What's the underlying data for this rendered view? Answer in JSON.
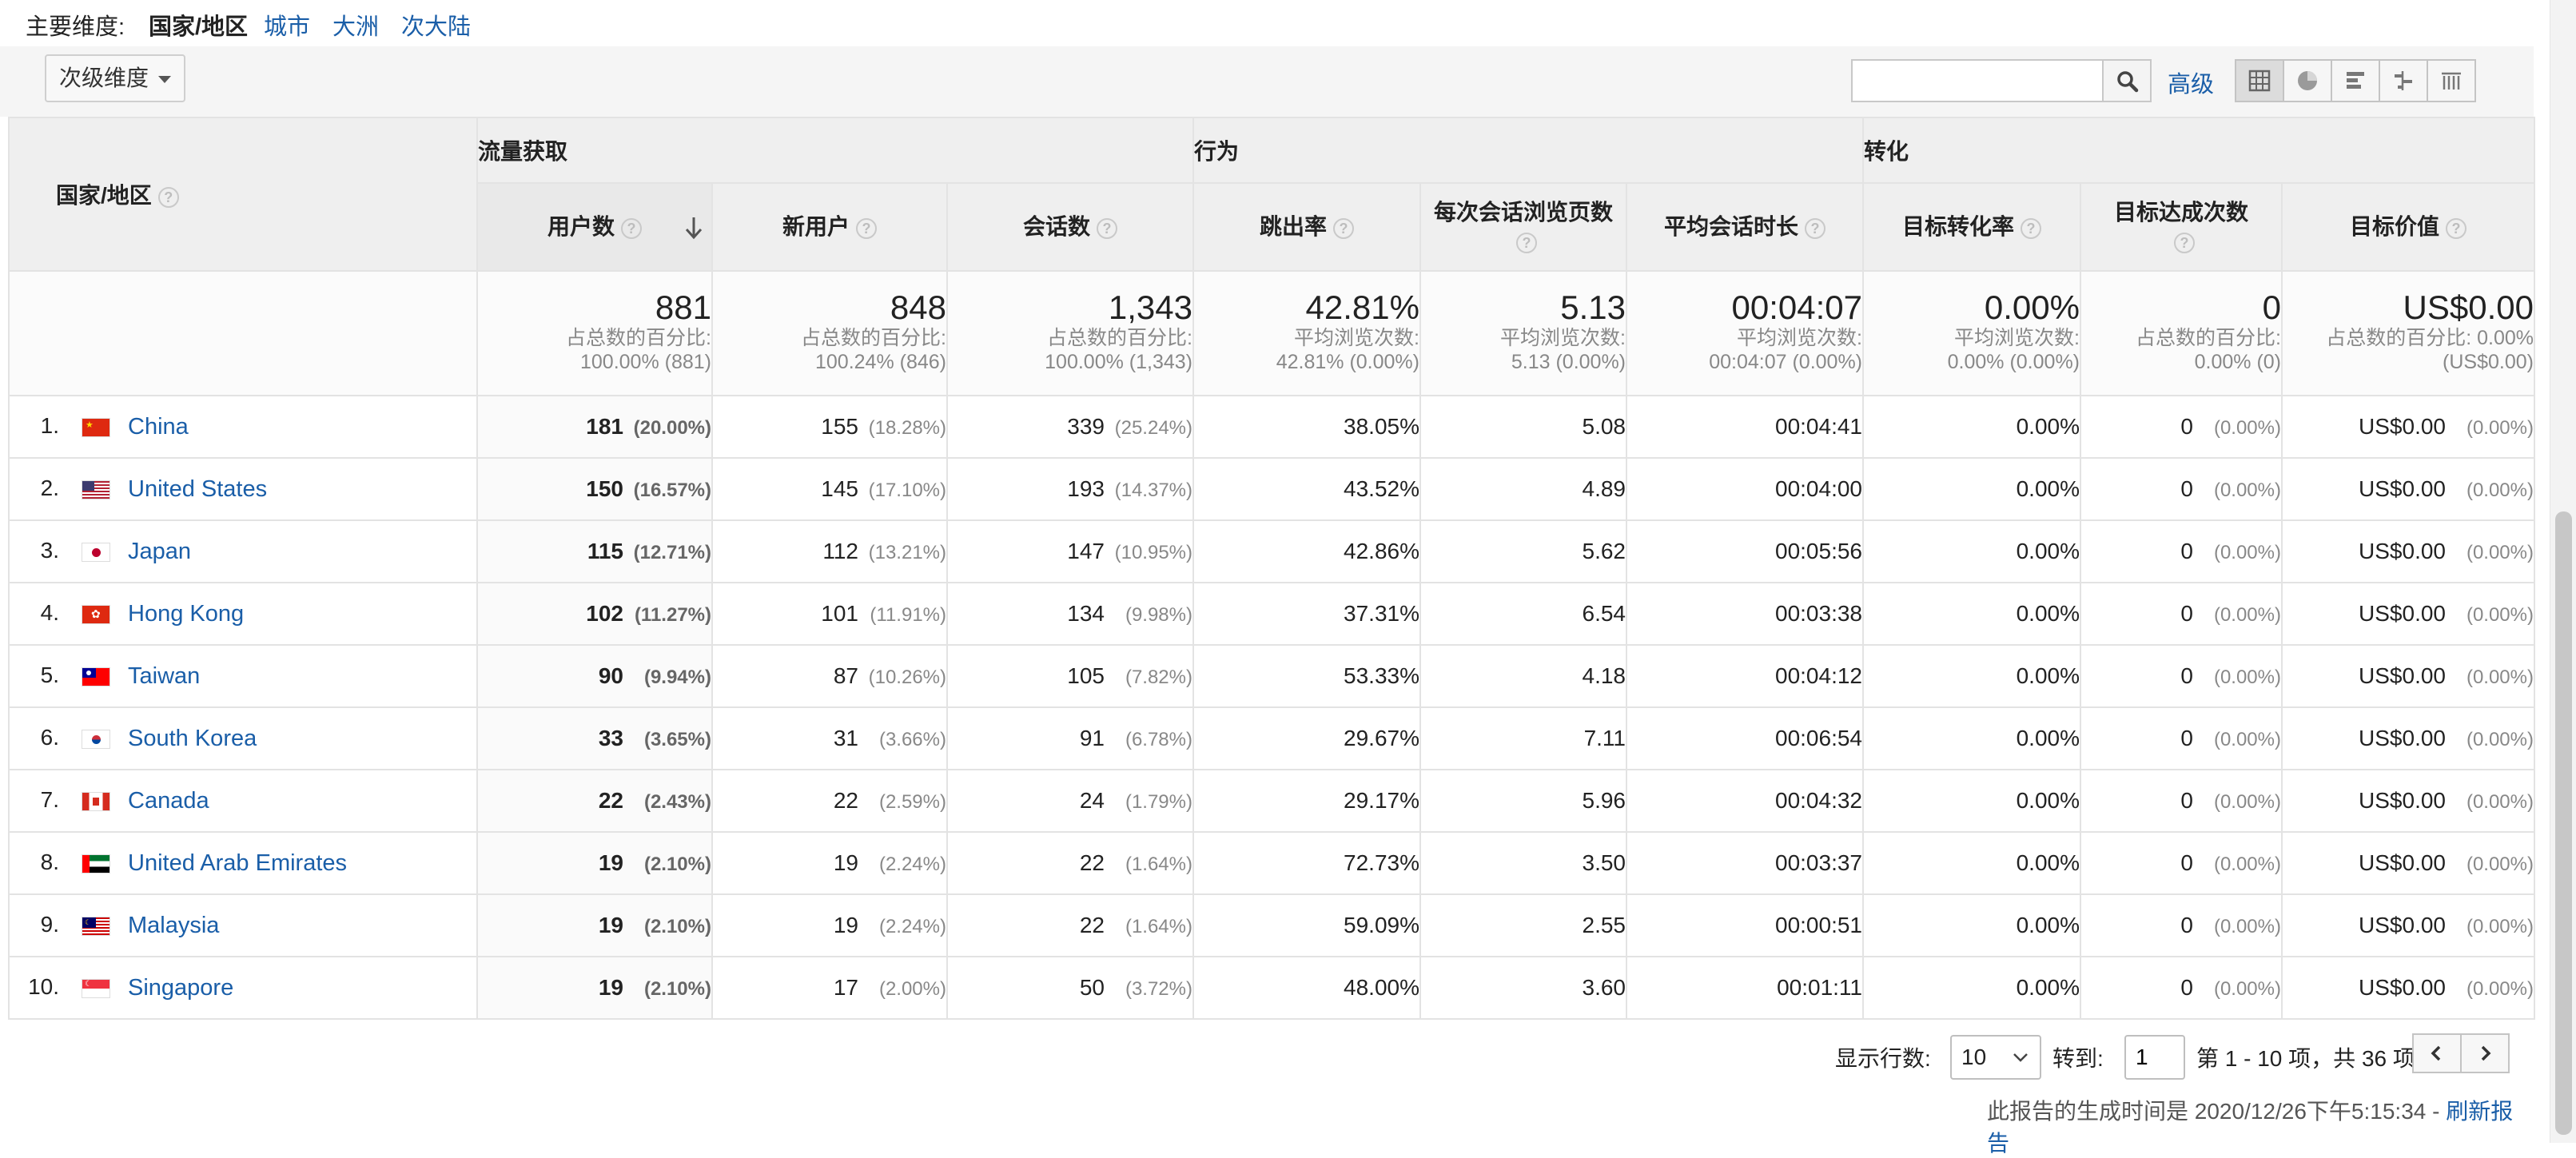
{
  "dimensions": {
    "label": "主要维度:",
    "current": "国家/地区",
    "options": [
      "城市",
      "大洲",
      "次大陆"
    ]
  },
  "toolbar": {
    "secondary_dimension": "次级维度",
    "search_placeholder": "",
    "advanced": "高级",
    "view_icons": [
      "table-view-icon",
      "pie-view-icon",
      "bar-view-icon",
      "comparison-view-icon",
      "pivot-view-icon"
    ]
  },
  "table": {
    "dimension_header": "国家/地区",
    "groups": [
      "流量获取",
      "行为",
      "转化"
    ],
    "columns": [
      "用户数",
      "新用户",
      "会话数",
      "跳出率",
      "每次会话浏览页数",
      "平均会话时长",
      "目标转化率",
      "目标达成次数",
      "目标价值"
    ],
    "totals": [
      {
        "value": "881",
        "sub1": "占总数的百分比:",
        "sub2": "100.00% (881)"
      },
      {
        "value": "848",
        "sub1": "占总数的百分比:",
        "sub2": "100.24% (846)"
      },
      {
        "value": "1,343",
        "sub1": "占总数的百分比:",
        "sub2": "100.00% (1,343)"
      },
      {
        "value": "42.81%",
        "sub1": "平均浏览次数:",
        "sub2": "42.81% (0.00%)"
      },
      {
        "value": "5.13",
        "sub1": "平均浏览次数:",
        "sub2": "5.13 (0.00%)"
      },
      {
        "value": "00:04:07",
        "sub1": "平均浏览次数:",
        "sub2": "00:04:07 (0.00%)"
      },
      {
        "value": "0.00%",
        "sub1": "平均浏览次数:",
        "sub2": "0.00% (0.00%)"
      },
      {
        "value": "0",
        "sub1": "占总数的百分比:",
        "sub2": "0.00% (0)"
      },
      {
        "value": "US$0.00",
        "sub1": "占总数的百分比: 0.00%",
        "sub2": "(US$0.00)"
      }
    ],
    "rows": [
      {
        "idx": "1.",
        "country": "China",
        "flag": "cn",
        "users": "181",
        "users_pct": "(20.00%)",
        "new": "155",
        "new_pct": "(18.28%)",
        "sessions": "339",
        "sessions_pct": "(25.24%)",
        "bounce": "38.05%",
        "pages": "5.08",
        "duration": "00:04:41",
        "conv": "0.00%",
        "goals": "0",
        "goals_pct": "(0.00%)",
        "value": "US$0.00",
        "value_pct": "(0.00%)"
      },
      {
        "idx": "2.",
        "country": "United States",
        "flag": "us",
        "users": "150",
        "users_pct": "(16.57%)",
        "new": "145",
        "new_pct": "(17.10%)",
        "sessions": "193",
        "sessions_pct": "(14.37%)",
        "bounce": "43.52%",
        "pages": "4.89",
        "duration": "00:04:00",
        "conv": "0.00%",
        "goals": "0",
        "goals_pct": "(0.00%)",
        "value": "US$0.00",
        "value_pct": "(0.00%)"
      },
      {
        "idx": "3.",
        "country": "Japan",
        "flag": "jp",
        "users": "115",
        "users_pct": "(12.71%)",
        "new": "112",
        "new_pct": "(13.21%)",
        "sessions": "147",
        "sessions_pct": "(10.95%)",
        "bounce": "42.86%",
        "pages": "5.62",
        "duration": "00:05:56",
        "conv": "0.00%",
        "goals": "0",
        "goals_pct": "(0.00%)",
        "value": "US$0.00",
        "value_pct": "(0.00%)"
      },
      {
        "idx": "4.",
        "country": "Hong Kong",
        "flag": "hk",
        "users": "102",
        "users_pct": "(11.27%)",
        "new": "101",
        "new_pct": "(11.91%)",
        "sessions": "134",
        "sessions_pct": "(9.98%)",
        "bounce": "37.31%",
        "pages": "6.54",
        "duration": "00:03:38",
        "conv": "0.00%",
        "goals": "0",
        "goals_pct": "(0.00%)",
        "value": "US$0.00",
        "value_pct": "(0.00%)"
      },
      {
        "idx": "5.",
        "country": "Taiwan",
        "flag": "tw",
        "users": "90",
        "users_pct": "(9.94%)",
        "new": "87",
        "new_pct": "(10.26%)",
        "sessions": "105",
        "sessions_pct": "(7.82%)",
        "bounce": "53.33%",
        "pages": "4.18",
        "duration": "00:04:12",
        "conv": "0.00%",
        "goals": "0",
        "goals_pct": "(0.00%)",
        "value": "US$0.00",
        "value_pct": "(0.00%)"
      },
      {
        "idx": "6.",
        "country": "South Korea",
        "flag": "kr",
        "users": "33",
        "users_pct": "(3.65%)",
        "new": "31",
        "new_pct": "(3.66%)",
        "sessions": "91",
        "sessions_pct": "(6.78%)",
        "bounce": "29.67%",
        "pages": "7.11",
        "duration": "00:06:54",
        "conv": "0.00%",
        "goals": "0",
        "goals_pct": "(0.00%)",
        "value": "US$0.00",
        "value_pct": "(0.00%)"
      },
      {
        "idx": "7.",
        "country": "Canada",
        "flag": "ca",
        "users": "22",
        "users_pct": "(2.43%)",
        "new": "22",
        "new_pct": "(2.59%)",
        "sessions": "24",
        "sessions_pct": "(1.79%)",
        "bounce": "29.17%",
        "pages": "5.96",
        "duration": "00:04:32",
        "conv": "0.00%",
        "goals": "0",
        "goals_pct": "(0.00%)",
        "value": "US$0.00",
        "value_pct": "(0.00%)"
      },
      {
        "idx": "8.",
        "country": "United Arab Emirates",
        "flag": "ae",
        "users": "19",
        "users_pct": "(2.10%)",
        "new": "19",
        "new_pct": "(2.24%)",
        "sessions": "22",
        "sessions_pct": "(1.64%)",
        "bounce": "72.73%",
        "pages": "3.50",
        "duration": "00:03:37",
        "conv": "0.00%",
        "goals": "0",
        "goals_pct": "(0.00%)",
        "value": "US$0.00",
        "value_pct": "(0.00%)"
      },
      {
        "idx": "9.",
        "country": "Malaysia",
        "flag": "my",
        "users": "19",
        "users_pct": "(2.10%)",
        "new": "19",
        "new_pct": "(2.24%)",
        "sessions": "22",
        "sessions_pct": "(1.64%)",
        "bounce": "59.09%",
        "pages": "2.55",
        "duration": "00:00:51",
        "conv": "0.00%",
        "goals": "0",
        "goals_pct": "(0.00%)",
        "value": "US$0.00",
        "value_pct": "(0.00%)"
      },
      {
        "idx": "10.",
        "country": "Singapore",
        "flag": "sg",
        "users": "19",
        "users_pct": "(2.10%)",
        "new": "17",
        "new_pct": "(2.00%)",
        "sessions": "50",
        "sessions_pct": "(3.72%)",
        "bounce": "48.00%",
        "pages": "3.60",
        "duration": "00:01:11",
        "conv": "0.00%",
        "goals": "0",
        "goals_pct": "(0.00%)",
        "value": "US$0.00",
        "value_pct": "(0.00%)"
      }
    ]
  },
  "footer": {
    "rows_label": "显示行数:",
    "rows_value": "10",
    "goto_label": "转到:",
    "goto_value": "1",
    "page_info": "第 1 - 10 项，共 36 项",
    "generated": "此报告的生成时间是 2020/12/26下午5:15:34 - ",
    "refresh": "刷新报告"
  },
  "colors": {
    "link": "#1a5ea8",
    "header_bg": "#efefef",
    "border": "#e3e3e3"
  }
}
